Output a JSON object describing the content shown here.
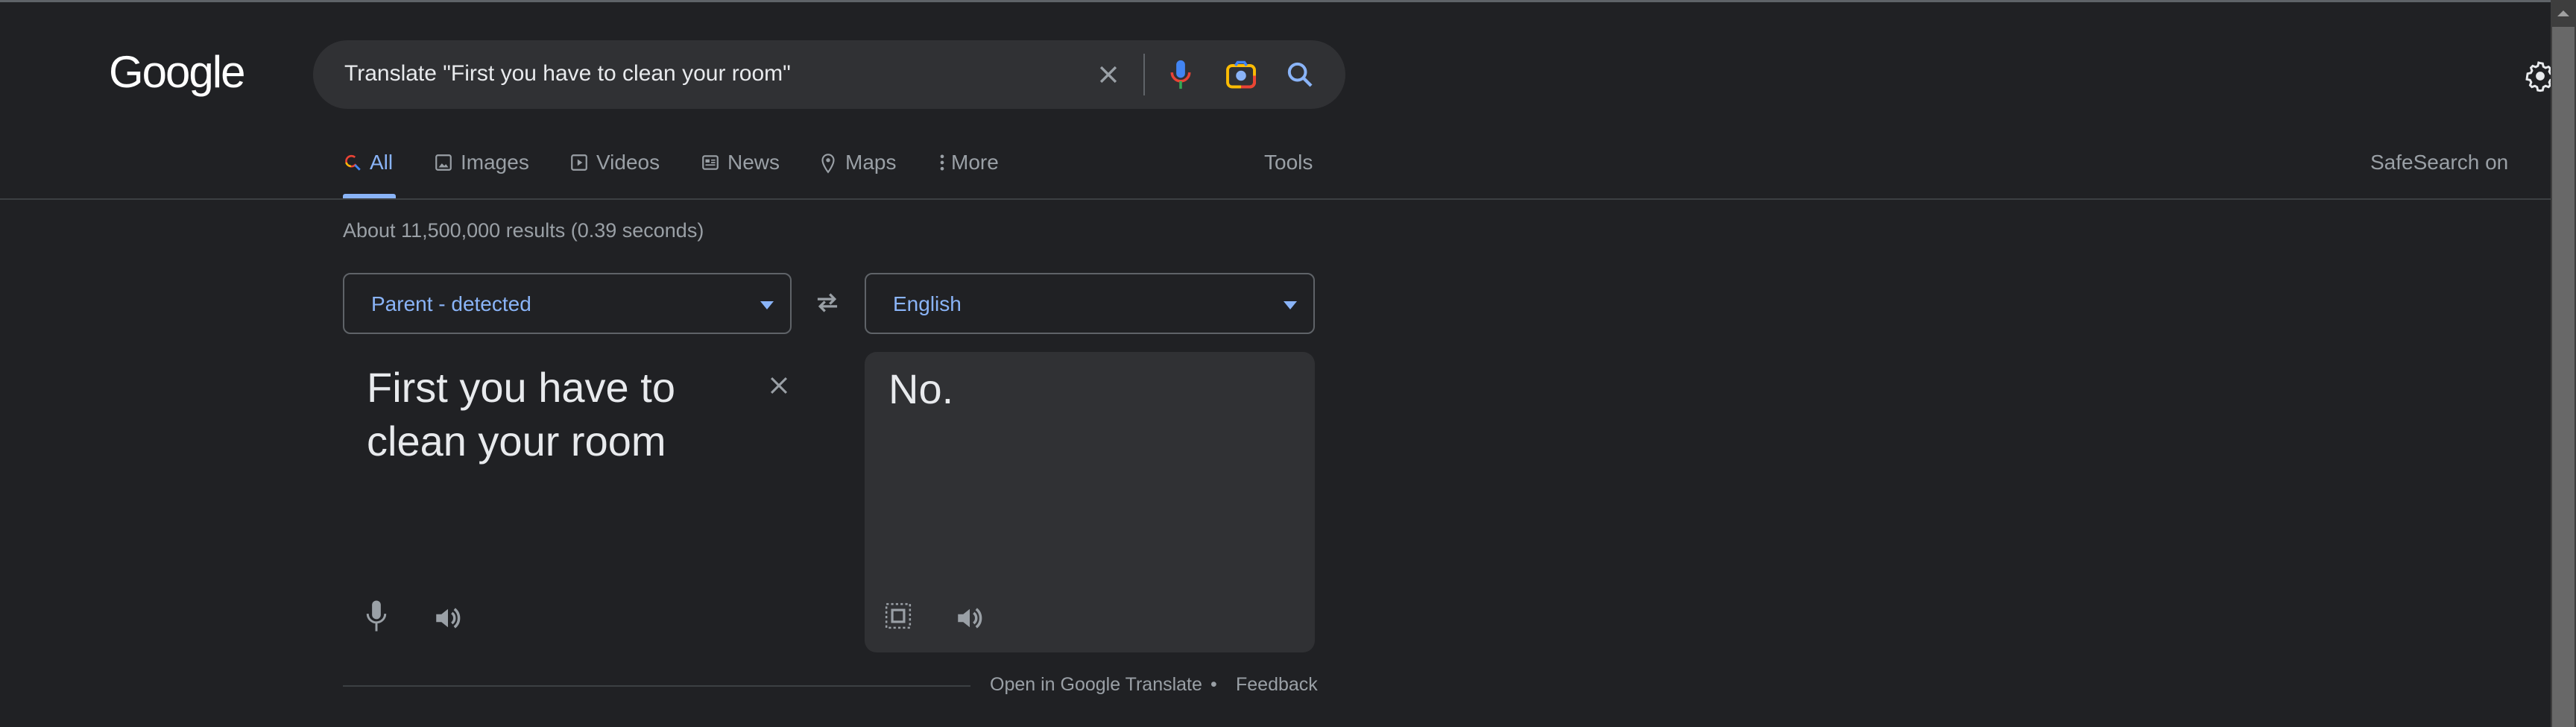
{
  "header": {
    "logo": "Google",
    "search": {
      "value": "Translate \"First you have to clean your room\""
    },
    "icons": [
      "clear-icon",
      "mic-icon",
      "camera-icon",
      "search-icon",
      "gear-icon"
    ]
  },
  "tabs": [
    {
      "label": "All",
      "icon": "search-icon",
      "active": true
    },
    {
      "label": "Images",
      "icon": "image-icon"
    },
    {
      "label": "Videos",
      "icon": "play-icon"
    },
    {
      "label": "News",
      "icon": "news-icon"
    },
    {
      "label": "Maps",
      "icon": "map-pin-icon"
    },
    {
      "label": "More",
      "icon": "more-vertical-icon"
    }
  ],
  "tools_label": "Tools",
  "safesearch_label": "SafeSearch on",
  "results_stats": "About 11,500,000 results (0.39 seconds)",
  "translate": {
    "source_language": "Parent - detected",
    "target_language": "English",
    "source_text": "First you have to clean your room",
    "output_text": "No.",
    "open_link": "Open in Google Translate",
    "separator": "•",
    "feedback": "Feedback"
  },
  "colors": {
    "background": "#202124",
    "surface": "#303134",
    "accent": "#8ab4f8",
    "muted": "#9aa0a6"
  }
}
